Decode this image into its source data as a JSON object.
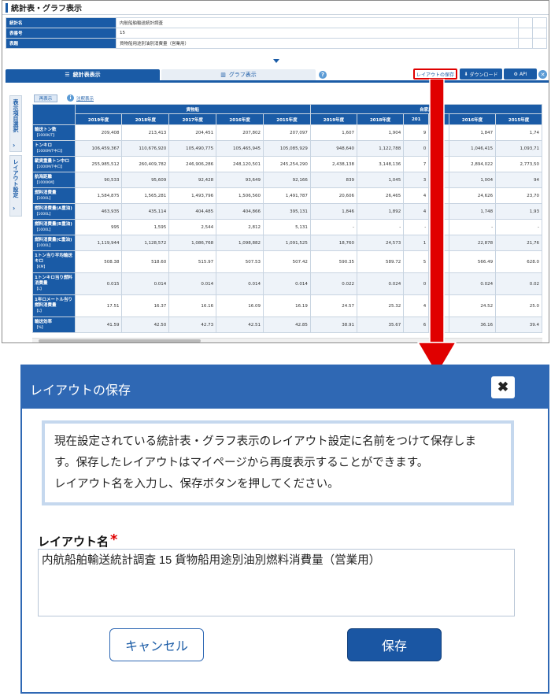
{
  "page": {
    "title": "統計表・グラフ表示",
    "info_rows": [
      {
        "label": "統計名",
        "value": "内航船舶輸送統計調査"
      },
      {
        "label": "表番号",
        "value": "15"
      },
      {
        "label": "表題",
        "value": "貨物船用途別油別消費量（営業用）"
      }
    ]
  },
  "tabs": {
    "table_view": "統計表表示",
    "graph_view": "グラフ表示"
  },
  "toolbar": {
    "layout_save": "レイアウトの保存",
    "download": "ダウンロード",
    "api": "API"
  },
  "side": {
    "items_select": "表示項目選択",
    "layout_setting": "レイアウト設定"
  },
  "table_controls": {
    "redisplay": "再表示",
    "notes": "注釈表示"
  },
  "colors": {
    "brand": "#1a5ba6",
    "highlight": "#e00000"
  },
  "grid": {
    "groups": [
      "貨物船",
      "自家用"
    ],
    "years_group1": [
      "2019年度",
      "2018年度",
      "2017年度",
      "2016年度",
      "2015年度"
    ],
    "years_group2": [
      "2019年度",
      "2018年度",
      "201",
      "",
      "2016年度",
      "2015年度"
    ],
    "rows": [
      {
        "label": "輸送トン数",
        "unit": "【1000K/T】",
        "values": [
          "209,408",
          "213,413",
          "204,451",
          "207,802",
          "207,097",
          "1,607",
          "1,904",
          "9",
          "",
          "1,847",
          "1,74"
        ]
      },
      {
        "label": "トンキロ",
        "unit": "【1000M/T中ロ】",
        "values": [
          "106,459,367",
          "110,676,920",
          "105,490,775",
          "105,465,945",
          "105,085,929",
          "948,640",
          "1,122,788",
          "0",
          "",
          "1,046,415",
          "1,093,71"
        ]
      },
      {
        "label": "載貨重量トン中ロ",
        "unit": "【1000M/T中ロ】",
        "values": [
          "255,985,512",
          "260,409,782",
          "246,906,286",
          "248,120,501",
          "245,254,290",
          "2,438,138",
          "3,148,136",
          "7",
          "",
          "2,894,022",
          "2,773,50"
        ]
      },
      {
        "label": "航海距離",
        "unit": "【1000KM】",
        "values": [
          "90,533",
          "95,609",
          "92,428",
          "93,649",
          "92,166",
          "839",
          "1,045",
          "3",
          "",
          "1,004",
          "94"
        ]
      },
      {
        "label": "燃料消費量",
        "unit": "【1000L】",
        "values": [
          "1,584,875",
          "1,565,281",
          "1,493,796",
          "1,506,560",
          "1,491,787",
          "20,606",
          "26,465",
          "4",
          "",
          "24,626",
          "23,70"
        ]
      },
      {
        "label": "燃料消費量(A重油)",
        "unit": "【1000L】",
        "values": [
          "463,935",
          "435,114",
          "404,485",
          "404,866",
          "395,131",
          "1,846",
          "1,892",
          "4",
          "",
          "1,748",
          "1,93"
        ]
      },
      {
        "label": "燃料消費量(B重油)",
        "unit": "【1000L】",
        "values": [
          "995",
          "1,595",
          "2,544",
          "2,812",
          "5,131",
          "-",
          "-",
          "-",
          "",
          "-",
          "-"
        ]
      },
      {
        "label": "燃料消費量(C重油)",
        "unit": "【1000L】",
        "values": [
          "1,119,944",
          "1,128,572",
          "1,086,768",
          "1,098,882",
          "1,091,525",
          "18,760",
          "24,573",
          "1",
          "",
          "22,878",
          "21,76"
        ]
      },
      {
        "label": "1トン当り平均輸送キロ",
        "unit": "【KM】",
        "values": [
          "508.38",
          "518.60",
          "515.97",
          "507.53",
          "507.42",
          "590.35",
          "589.72",
          "5",
          "",
          "566.49",
          "628.0"
        ]
      },
      {
        "label": "1トンキロ当り燃料消費量",
        "unit": "【L】",
        "values": [
          "0.015",
          "0.014",
          "0.014",
          "0.014",
          "0.014",
          "0.022",
          "0.024",
          "0",
          "",
          "0.024",
          "0.02"
        ]
      },
      {
        "label": "1年ロメートル当り燃料消費量",
        "unit": "【L】",
        "values": [
          "17.51",
          "16.37",
          "16.16",
          "16.09",
          "16.19",
          "24.57",
          "25.32",
          "4",
          "",
          "24.52",
          "25.0"
        ]
      },
      {
        "label": "輸送効率",
        "unit": "【%】",
        "values": [
          "41.59",
          "42.50",
          "42.73",
          "42.51",
          "42.85",
          "38.91",
          "35.67",
          "6",
          "",
          "36.16",
          "39.4"
        ]
      }
    ]
  },
  "dialog": {
    "title": "レイアウトの保存",
    "message_lines": [
      "現在設定されている統計表・グラフ表示のレイアウト設定に名前をつけて保存しま",
      "す。保存したレイアウトはマイページから再度表示することができます。",
      "レイアウト名を入力し、保存ボタンを押してください。"
    ],
    "name_label": "レイアウト名",
    "required_mark": "*",
    "name_value": "内航船舶輸送統計調査 15 貨物船用途別油別燃料消費量（営業用）",
    "cancel": "キャンセル",
    "save": "保存"
  }
}
